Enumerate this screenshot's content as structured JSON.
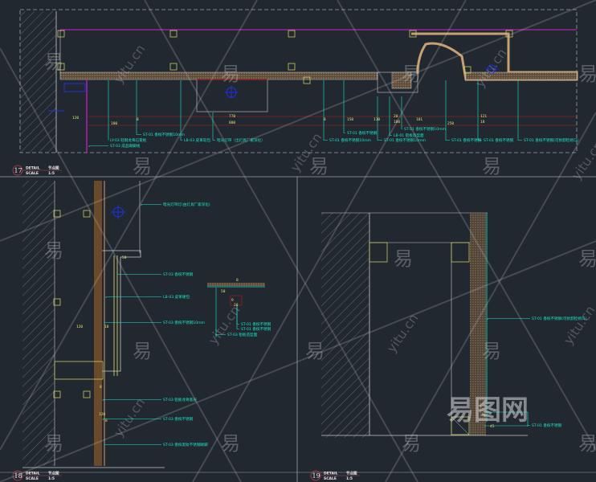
{
  "details": [
    {
      "number": "17",
      "title_label": "DETAIL",
      "title": "节点图",
      "scale_label": "SCALE",
      "scale": "1:5"
    },
    {
      "number": "18",
      "title_label": "DETAIL",
      "title": "节点图",
      "scale_label": "SCALE",
      "scale": "1:5"
    },
    {
      "number": "19",
      "title_label": "DETAIL",
      "title": "节点图",
      "scale_label": "SCALE",
      "scale": "1:5"
    }
  ],
  "detail17_labels": [
    "LY-03 轻钢龙骨石膏板",
    "ST-03 成品踢脚线",
    "ST-01 香槟不锈钢10mm",
    "LB-03 皮革软包",
    "暗光灯带（出灯具厂家深化）",
    "ST-01 香槟不锈钢10mm",
    "ST-01 香槟不锈钢",
    "ST-01 香槟不锈钢10mm",
    "ST-01 香槟不锈钢10mm",
    "LB-01 铝板造型面",
    "ST-01 香槟不锈钢",
    "ST-01 香槟不锈钢",
    "ST-01 香槟不锈钢(可拆卸检修口)"
  ],
  "detail17_dims": [
    "120",
    "100",
    "8",
    "770",
    "800",
    "8",
    "150",
    "110",
    "20",
    "180",
    "181",
    "250",
    "121",
    "18"
  ],
  "detail18_labels": [
    "暗光灯带灯(由灯具厂家深化)",
    "ST-03 香槟不锈钢",
    "LB-03 皮革硬包",
    "ST-03 香槟不锈钢10mm",
    "ST-01 香槟不锈钢",
    "ST-01 香槟不锈钢",
    "ST-03 铝板造型面",
    "ST-03 铝板龙骨基层",
    "ST-03 香槟不锈钢",
    "ST-03 香槟黑钛不锈钢踢脚"
  ],
  "detail18_dims": [
    "50",
    "8",
    "50",
    "120",
    "18",
    "9",
    "20",
    "8",
    "120",
    "8"
  ],
  "detail19_labels": [
    "ST-01 香槟不锈钢(可拆卸检修口)",
    "ST-01 香槟不锈钢"
  ],
  "detail19_dims": [
    "5",
    "45"
  ],
  "watermark": {
    "char": "易",
    "site": "yitu.cn",
    "brand": "易图网"
  },
  "colors": {
    "background": "#212830",
    "leader": "#19e6c8",
    "dimension": "#e8e070",
    "magenta": "#d020d0",
    "red": "#b02020"
  }
}
